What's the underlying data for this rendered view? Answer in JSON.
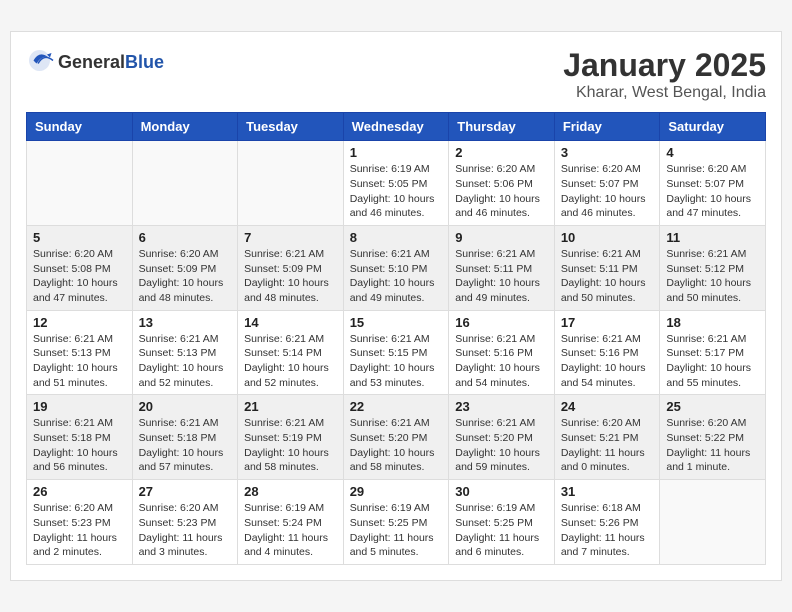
{
  "header": {
    "logo_general": "General",
    "logo_blue": "Blue",
    "month_title": "January 2025",
    "location": "Kharar, West Bengal, India"
  },
  "weekdays": [
    "Sunday",
    "Monday",
    "Tuesday",
    "Wednesday",
    "Thursday",
    "Friday",
    "Saturday"
  ],
  "weeks": [
    [
      {
        "day": "",
        "info": ""
      },
      {
        "day": "",
        "info": ""
      },
      {
        "day": "",
        "info": ""
      },
      {
        "day": "1",
        "info": "Sunrise: 6:19 AM\nSunset: 5:05 PM\nDaylight: 10 hours\nand 46 minutes."
      },
      {
        "day": "2",
        "info": "Sunrise: 6:20 AM\nSunset: 5:06 PM\nDaylight: 10 hours\nand 46 minutes."
      },
      {
        "day": "3",
        "info": "Sunrise: 6:20 AM\nSunset: 5:07 PM\nDaylight: 10 hours\nand 46 minutes."
      },
      {
        "day": "4",
        "info": "Sunrise: 6:20 AM\nSunset: 5:07 PM\nDaylight: 10 hours\nand 47 minutes."
      }
    ],
    [
      {
        "day": "5",
        "info": "Sunrise: 6:20 AM\nSunset: 5:08 PM\nDaylight: 10 hours\nand 47 minutes."
      },
      {
        "day": "6",
        "info": "Sunrise: 6:20 AM\nSunset: 5:09 PM\nDaylight: 10 hours\nand 48 minutes."
      },
      {
        "day": "7",
        "info": "Sunrise: 6:21 AM\nSunset: 5:09 PM\nDaylight: 10 hours\nand 48 minutes."
      },
      {
        "day": "8",
        "info": "Sunrise: 6:21 AM\nSunset: 5:10 PM\nDaylight: 10 hours\nand 49 minutes."
      },
      {
        "day": "9",
        "info": "Sunrise: 6:21 AM\nSunset: 5:11 PM\nDaylight: 10 hours\nand 49 minutes."
      },
      {
        "day": "10",
        "info": "Sunrise: 6:21 AM\nSunset: 5:11 PM\nDaylight: 10 hours\nand 50 minutes."
      },
      {
        "day": "11",
        "info": "Sunrise: 6:21 AM\nSunset: 5:12 PM\nDaylight: 10 hours\nand 50 minutes."
      }
    ],
    [
      {
        "day": "12",
        "info": "Sunrise: 6:21 AM\nSunset: 5:13 PM\nDaylight: 10 hours\nand 51 minutes."
      },
      {
        "day": "13",
        "info": "Sunrise: 6:21 AM\nSunset: 5:13 PM\nDaylight: 10 hours\nand 52 minutes."
      },
      {
        "day": "14",
        "info": "Sunrise: 6:21 AM\nSunset: 5:14 PM\nDaylight: 10 hours\nand 52 minutes."
      },
      {
        "day": "15",
        "info": "Sunrise: 6:21 AM\nSunset: 5:15 PM\nDaylight: 10 hours\nand 53 minutes."
      },
      {
        "day": "16",
        "info": "Sunrise: 6:21 AM\nSunset: 5:16 PM\nDaylight: 10 hours\nand 54 minutes."
      },
      {
        "day": "17",
        "info": "Sunrise: 6:21 AM\nSunset: 5:16 PM\nDaylight: 10 hours\nand 54 minutes."
      },
      {
        "day": "18",
        "info": "Sunrise: 6:21 AM\nSunset: 5:17 PM\nDaylight: 10 hours\nand 55 minutes."
      }
    ],
    [
      {
        "day": "19",
        "info": "Sunrise: 6:21 AM\nSunset: 5:18 PM\nDaylight: 10 hours\nand 56 minutes."
      },
      {
        "day": "20",
        "info": "Sunrise: 6:21 AM\nSunset: 5:18 PM\nDaylight: 10 hours\nand 57 minutes."
      },
      {
        "day": "21",
        "info": "Sunrise: 6:21 AM\nSunset: 5:19 PM\nDaylight: 10 hours\nand 58 minutes."
      },
      {
        "day": "22",
        "info": "Sunrise: 6:21 AM\nSunset: 5:20 PM\nDaylight: 10 hours\nand 58 minutes."
      },
      {
        "day": "23",
        "info": "Sunrise: 6:21 AM\nSunset: 5:20 PM\nDaylight: 10 hours\nand 59 minutes."
      },
      {
        "day": "24",
        "info": "Sunrise: 6:20 AM\nSunset: 5:21 PM\nDaylight: 11 hours\nand 0 minutes."
      },
      {
        "day": "25",
        "info": "Sunrise: 6:20 AM\nSunset: 5:22 PM\nDaylight: 11 hours\nand 1 minute."
      }
    ],
    [
      {
        "day": "26",
        "info": "Sunrise: 6:20 AM\nSunset: 5:23 PM\nDaylight: 11 hours\nand 2 minutes."
      },
      {
        "day": "27",
        "info": "Sunrise: 6:20 AM\nSunset: 5:23 PM\nDaylight: 11 hours\nand 3 minutes."
      },
      {
        "day": "28",
        "info": "Sunrise: 6:19 AM\nSunset: 5:24 PM\nDaylight: 11 hours\nand 4 minutes."
      },
      {
        "day": "29",
        "info": "Sunrise: 6:19 AM\nSunset: 5:25 PM\nDaylight: 11 hours\nand 5 minutes."
      },
      {
        "day": "30",
        "info": "Sunrise: 6:19 AM\nSunset: 5:25 PM\nDaylight: 11 hours\nand 6 minutes."
      },
      {
        "day": "31",
        "info": "Sunrise: 6:18 AM\nSunset: 5:26 PM\nDaylight: 11 hours\nand 7 minutes."
      },
      {
        "day": "",
        "info": ""
      }
    ]
  ]
}
